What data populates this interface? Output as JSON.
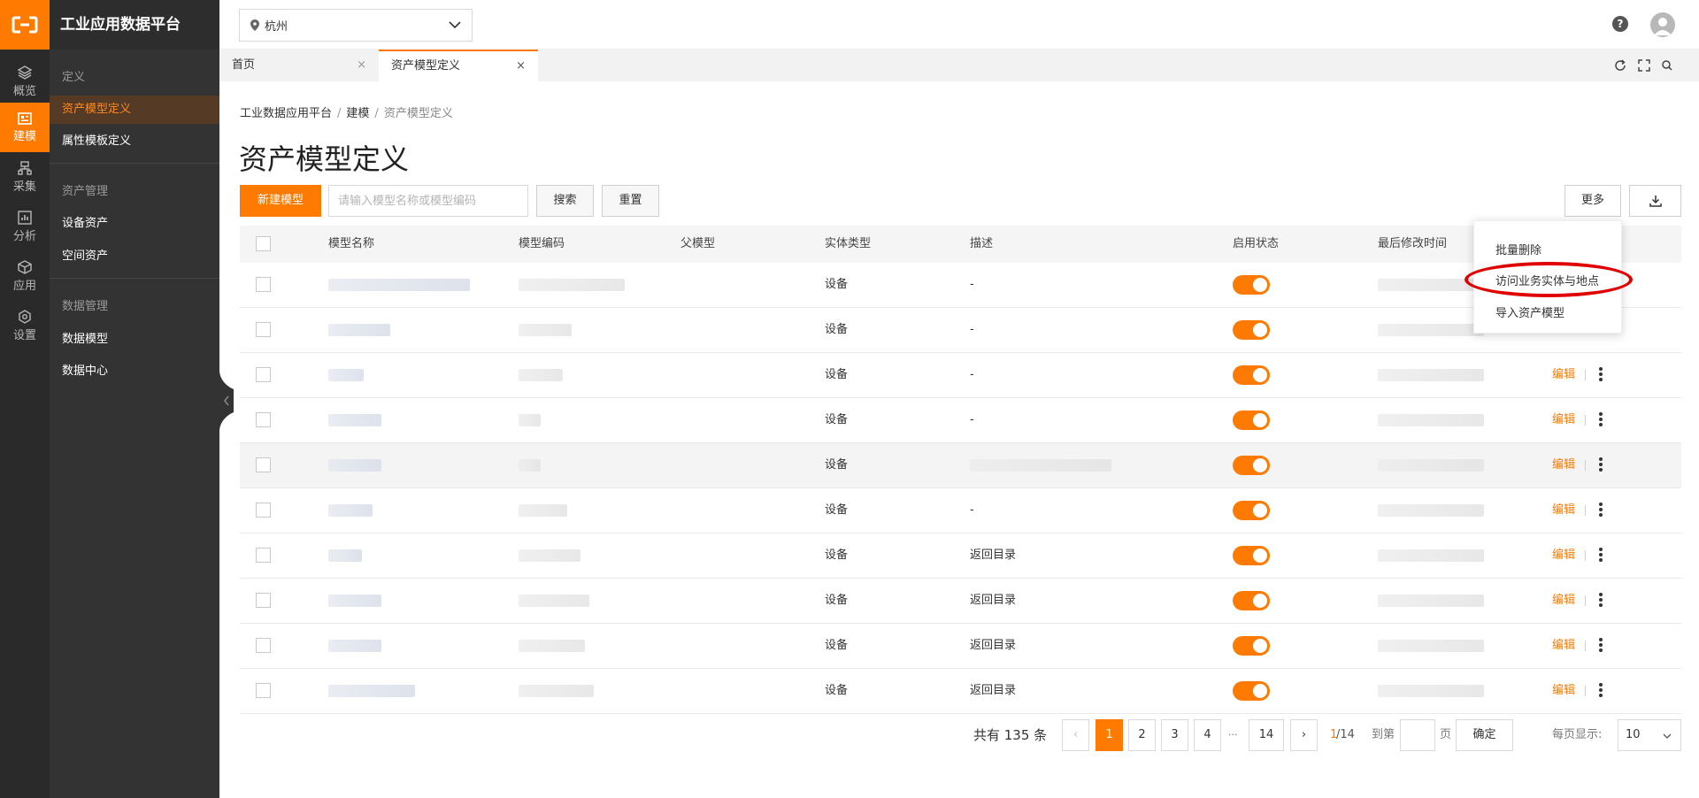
{
  "app": {
    "title": "工业应用数据平台"
  },
  "rail": [
    {
      "label": "概览",
      "icon": "layers-icon"
    },
    {
      "label": "建模",
      "icon": "model-icon",
      "active": true
    },
    {
      "label": "采集",
      "icon": "collect-icon"
    },
    {
      "label": "分析",
      "icon": "chart-icon"
    },
    {
      "label": "应用",
      "icon": "cube-icon"
    },
    {
      "label": "设置",
      "icon": "settings-icon"
    }
  ],
  "submenu": {
    "group_define": "定义",
    "asset_model_def": "资产模型定义",
    "attr_template_def": "属性模板定义",
    "group_asset_mgmt": "资产管理",
    "device_assets": "设备资产",
    "space_assets": "空间资产",
    "group_data_mgmt": "数据管理",
    "data_model": "数据模型",
    "data_center": "数据中心"
  },
  "topbar": {
    "city": "杭州",
    "help": "?"
  },
  "tabs": [
    {
      "label": "首页",
      "close": "×"
    },
    {
      "label": "资产模型定义",
      "close": "×"
    }
  ],
  "breadcrumb": {
    "root": "工业数据应用平台",
    "parent": "建模",
    "current": "资产模型定义",
    "sep": "/"
  },
  "page": {
    "title": "资产模型定义"
  },
  "toolbar": {
    "new_model": "新建模型",
    "search_placeholder": "请输入模型名称或模型编码",
    "search": "搜索",
    "reset": "重置",
    "more": "更多"
  },
  "table": {
    "columns": {
      "name": "模型名称",
      "code": "模型编码",
      "parent": "父模型",
      "entity_type": "实体类型",
      "desc": "描述",
      "enabled": "启用状态",
      "modified": "最后修改时间"
    },
    "edit_label": "编辑",
    "rows": [
      {
        "entity_type": "设备",
        "desc": "-",
        "enabled": true
      },
      {
        "entity_type": "设备",
        "desc": "-",
        "enabled": true
      },
      {
        "entity_type": "设备",
        "desc": "-",
        "enabled": true
      },
      {
        "entity_type": "设备",
        "desc": "-",
        "enabled": true
      },
      {
        "entity_type": "设备",
        "desc": "",
        "enabled": true
      },
      {
        "entity_type": "设备",
        "desc": "-",
        "enabled": true
      },
      {
        "entity_type": "设备",
        "desc": "返回目录",
        "enabled": true
      },
      {
        "entity_type": "设备",
        "desc": "返回目录",
        "enabled": true
      },
      {
        "entity_type": "设备",
        "desc": "返回目录",
        "enabled": true
      },
      {
        "entity_type": "设备",
        "desc": "返回目录",
        "enabled": true
      }
    ]
  },
  "more_menu": {
    "batch_delete": "批量删除",
    "access_entities": "访问业务实体与地点",
    "import_model": "导入资产模型"
  },
  "pagination": {
    "total": "共有 135 条",
    "pages": [
      "1",
      "2",
      "3",
      "4"
    ],
    "ellipsis": "···",
    "last": "14",
    "current": "1",
    "of_total": "/14",
    "goto": "到第",
    "page_unit": "页",
    "confirm": "确定",
    "per_page": "每页显示:",
    "page_size": "10"
  },
  "colors": {
    "accent": "#ff7a00",
    "rail_bg": "#2a2a2a",
    "menu_bg": "#333333"
  }
}
